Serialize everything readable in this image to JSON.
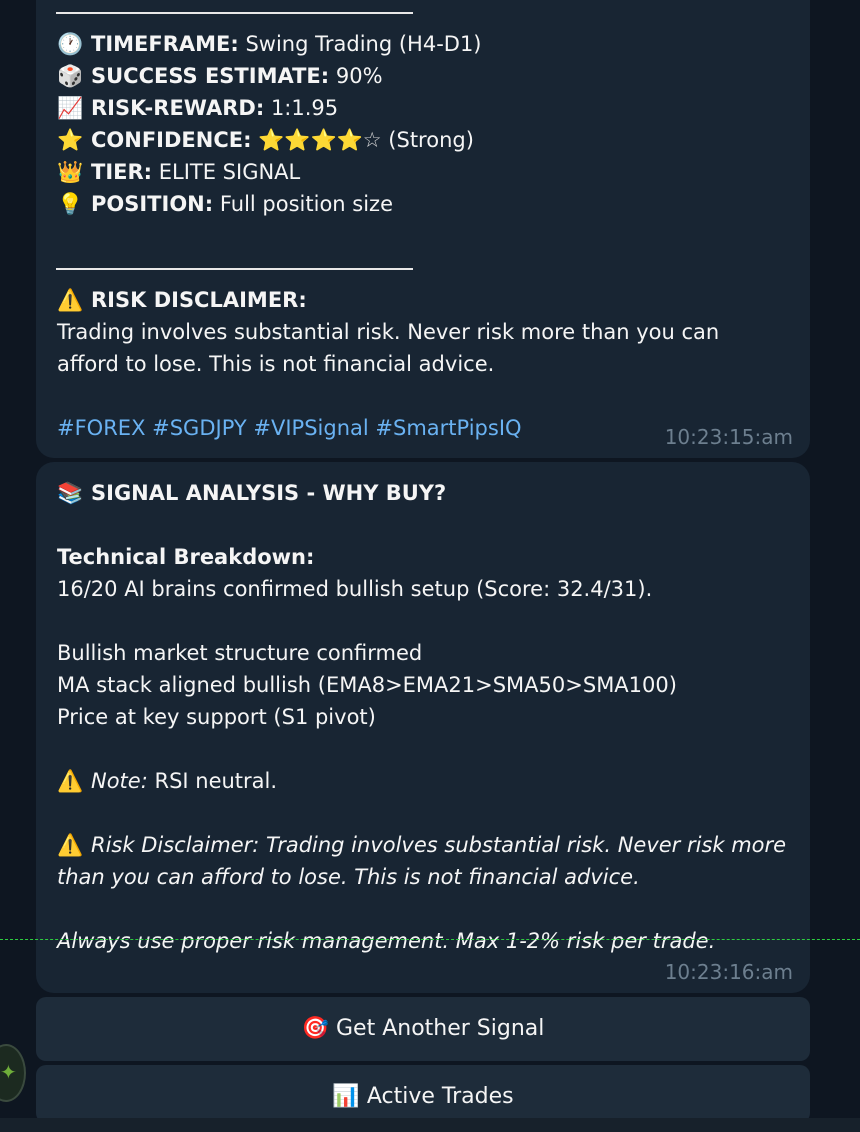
{
  "message1": {
    "timeframe": {
      "icon": "🕐",
      "label": "TIMEFRAME:",
      "value": " Swing Trading (H4-D1)"
    },
    "success": {
      "icon": "🎲",
      "label": "SUCCESS ESTIMATE:",
      "value": " 90%"
    },
    "risk_reward": {
      "icon": "📈",
      "label": "RISK-REWARD:",
      "value": " 1:1.95"
    },
    "confidence": {
      "icon": "⭐",
      "label": "CONFIDENCE:",
      "stars_filled": "⭐⭐⭐⭐",
      "star_empty": "☆",
      "suffix": " (Strong)",
      "rating": "4 of 5"
    },
    "tier": {
      "icon": "👑",
      "label": "TIER:",
      "value": " ELITE SIGNAL"
    },
    "position": {
      "icon": "💡",
      "label": "POSITION:",
      "value": " Full position size"
    },
    "disclaimer": {
      "icon": "⚠️",
      "title": "RISK DISCLAIMER:",
      "line1": "Trading involves substantial risk. Never risk more than you can",
      "line2": "afford to lose. This is not financial advice."
    },
    "hashtags": "#FOREX #SGDJPY #VIPSignal #SmartPipsIQ",
    "time": "10:23:15:am"
  },
  "message2": {
    "heading_icon": "📚",
    "heading": "SIGNAL ANALYSIS - WHY BUY?",
    "breakdown_title": "Technical Breakdown:",
    "breakdown_text": "16/20 AI brains confirmed bullish setup (Score: 32.4/31).",
    "points": [
      "Bullish market structure confirmed",
      "MA stack aligned bullish (EMA8>EMA21>SMA50>SMA100)",
      "Price at key support (S1 pivot)"
    ],
    "note_icon": "⚠️",
    "note_label": "Note:",
    "note_text": " RSI neutral.",
    "disclaimer_icon": "⚠️",
    "disclaimer_line1": "Risk Disclaimer: Trading involves substantial risk. Never risk more",
    "disclaimer_line2": "than you can afford to lose. This is not financial advice.",
    "risk_mgmt": "Always use proper risk management. Max 1-2% risk per trade.",
    "time": "10:23:16:am"
  },
  "buttons": {
    "get_another": {
      "icon": "🎯",
      "label": "Get Another Signal"
    },
    "active_trades": {
      "icon": "📊",
      "label": "Active Trades"
    }
  },
  "colors": {
    "background": "#0e1621",
    "bubble": "#182533",
    "link": "#6ab2f2",
    "timestamp": "#6d7f8f",
    "button": "#1e2c3a"
  }
}
